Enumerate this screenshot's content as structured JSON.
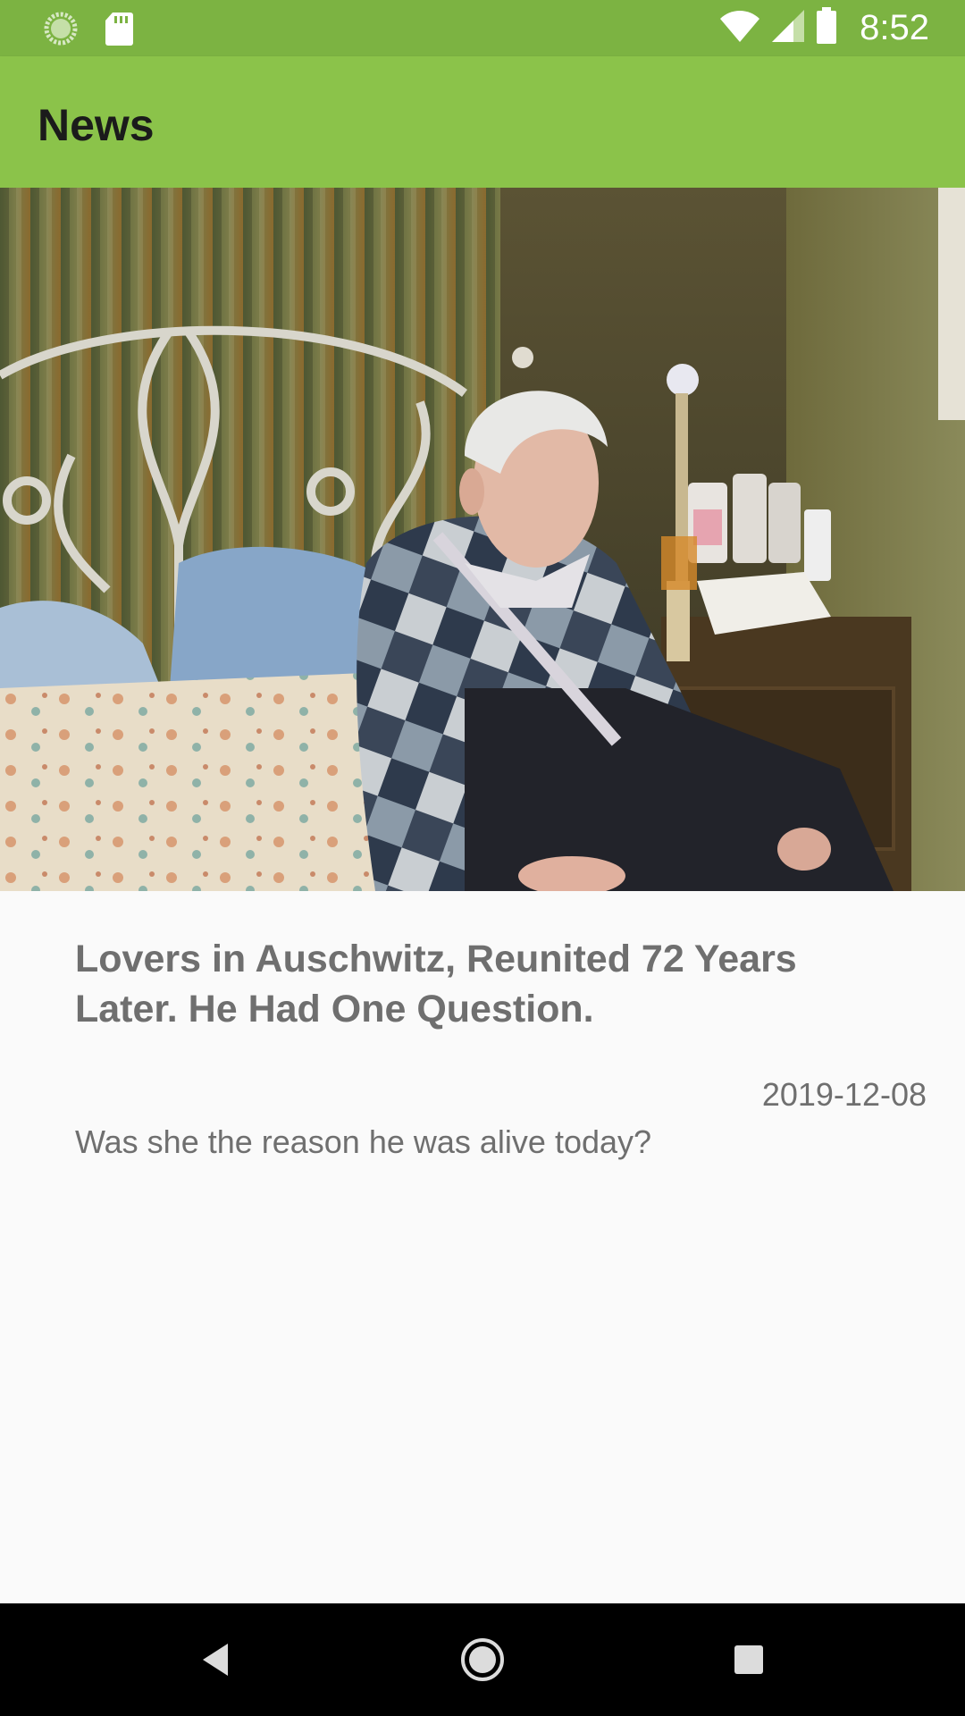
{
  "status_bar": {
    "time": "8:52",
    "icons": [
      "loading-icon",
      "sd-card-icon",
      "wifi-icon",
      "signal-icon",
      "battery-icon"
    ]
  },
  "app_bar": {
    "title": "News"
  },
  "article": {
    "image_alt": "Elderly man sitting on a bed",
    "headline": "Lovers in Auschwitz, Reunited 72 Years Later. He Had One Question.",
    "date": "2019-12-08",
    "summary": "Was she the reason he was alive today?"
  },
  "nav_bar": {
    "icons": [
      "back-icon",
      "home-icon",
      "recents-icon"
    ]
  },
  "colors": {
    "status_bar": "#7cb342",
    "app_bar": "#8bc34a",
    "background": "#fafafa",
    "text": "#6f6f6f"
  }
}
